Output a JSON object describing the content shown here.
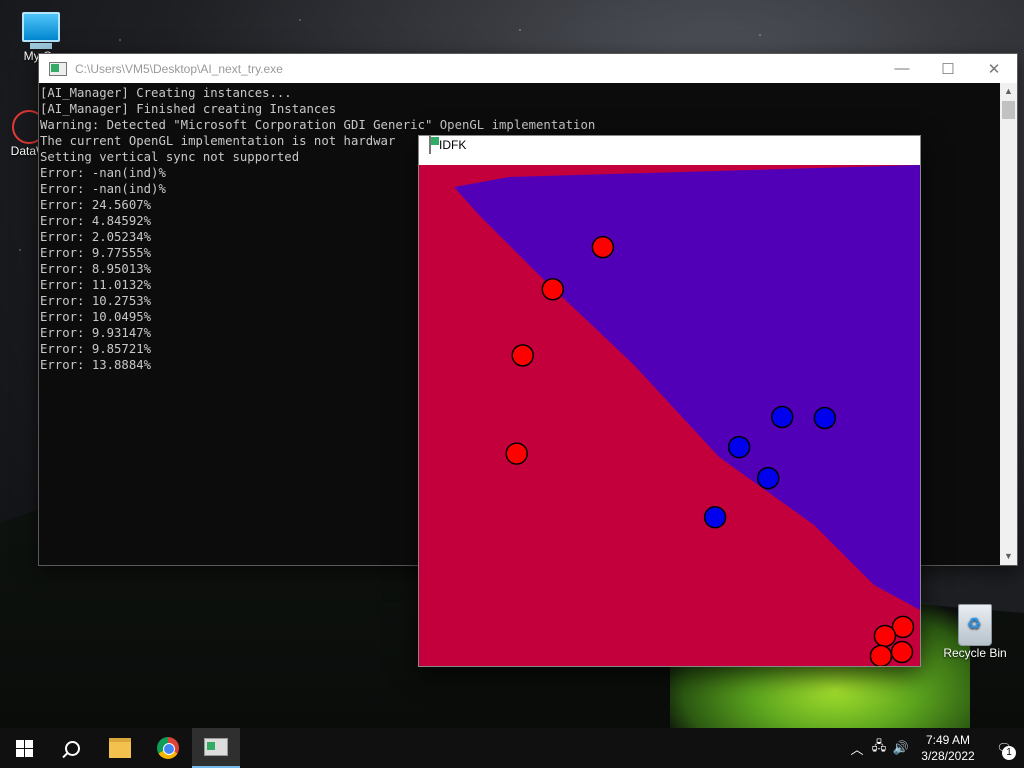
{
  "desktop": {
    "icons": [
      {
        "label": "My Co"
      },
      {
        "label": "DataW"
      },
      {
        "label": "Recycle Bin"
      }
    ]
  },
  "console_window": {
    "title": "C:\\Users\\VM5\\Desktop\\AI_next_try.exe",
    "minimize": "—",
    "maximize": "☐",
    "close": "✕",
    "lines": [
      "[AI_Manager] Creating instances...",
      "[AI_Manager] Finished creating Instances",
      "Warning: Detected \"Microsoft Corporation GDI Generic\" OpenGL implementation",
      "The current OpenGL implementation is not hardwar",
      "Setting vertical sync not supported",
      "Error: -nan(ind)%",
      "Error: -nan(ind)%",
      "Error: 24.5607%",
      "Error: 4.84592%",
      "Error: 2.05234%",
      "Error: 9.77555%",
      "Error: 8.95013%",
      "Error: 11.0132%",
      "Error: 10.2753%",
      "Error: 10.0495%",
      "Error: 9.93147%",
      "Error: 9.85721%",
      "Error: 13.8884%"
    ]
  },
  "idfk_window": {
    "title": "IDFK",
    "minimize": "—",
    "maximize": "☐",
    "close": "✕",
    "colors": {
      "red_region": "#c4003c",
      "blue_region": "#5200b8",
      "red_point": "#ff0000",
      "blue_point": "#0000ee"
    },
    "points": [
      {
        "cls": "red",
        "x": 0.367,
        "y": 0.164
      },
      {
        "cls": "red",
        "x": 0.267,
        "y": 0.248
      },
      {
        "cls": "red",
        "x": 0.207,
        "y": 0.38
      },
      {
        "cls": "red",
        "x": 0.195,
        "y": 0.576
      },
      {
        "cls": "blue",
        "x": 0.725,
        "y": 0.503
      },
      {
        "cls": "blue",
        "x": 0.81,
        "y": 0.505
      },
      {
        "cls": "blue",
        "x": 0.639,
        "y": 0.563
      },
      {
        "cls": "blue",
        "x": 0.697,
        "y": 0.625
      },
      {
        "cls": "blue",
        "x": 0.591,
        "y": 0.703
      },
      {
        "cls": "red",
        "x": 0.966,
        "y": 0.922
      },
      {
        "cls": "red",
        "x": 0.93,
        "y": 0.94
      },
      {
        "cls": "red",
        "x": 0.964,
        "y": 0.972
      },
      {
        "cls": "red",
        "x": 0.922,
        "y": 0.98
      }
    ]
  },
  "taskbar": {
    "time": "7:49 AM",
    "date": "3/28/2022",
    "notification_count": "1",
    "tray_icons": [
      "chevron-up",
      "network",
      "volume"
    ]
  }
}
